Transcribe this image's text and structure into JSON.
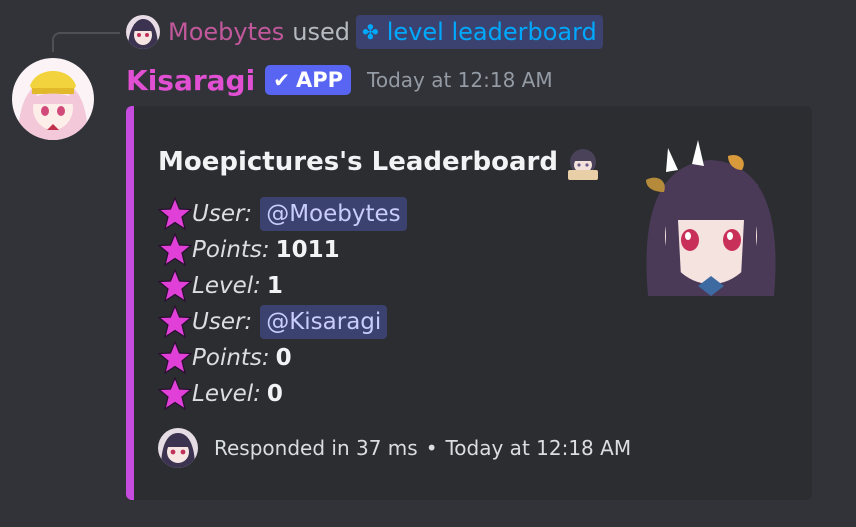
{
  "reply": {
    "username": "Moebytes",
    "used_text": "used",
    "command_icon": "slash-command-icon",
    "command_text": "level leaderboard"
  },
  "message": {
    "author": "Kisaragi",
    "badge_check": "✔",
    "badge_text": "APP",
    "timestamp": "Today at 12:18 AM"
  },
  "embed": {
    "accent_color": "#c64ce0",
    "title": "Moepictures's Leaderboard",
    "fields": [
      {
        "label": "User:",
        "value": "@Moebytes",
        "mention": true
      },
      {
        "label": "Points:",
        "value": "1011",
        "mention": false
      },
      {
        "label": "Level:",
        "value": "1",
        "mention": false
      },
      {
        "label": "User:",
        "value": "@Kisaragi",
        "mention": true
      },
      {
        "label": "Points:",
        "value": "0",
        "mention": false
      },
      {
        "label": "Level:",
        "value": "0",
        "mention": false
      }
    ],
    "footer": {
      "response": "Responded in 37 ms",
      "separator": "•",
      "time": "Today at 12:18 AM"
    }
  },
  "colors": {
    "background": "#313338",
    "embed_bg": "#2b2d31",
    "author": "#e150d3",
    "reply_name": "#c2589c",
    "mention_bg": "#3c4270",
    "app_badge": "#5865f2",
    "star": "#e040d8"
  }
}
